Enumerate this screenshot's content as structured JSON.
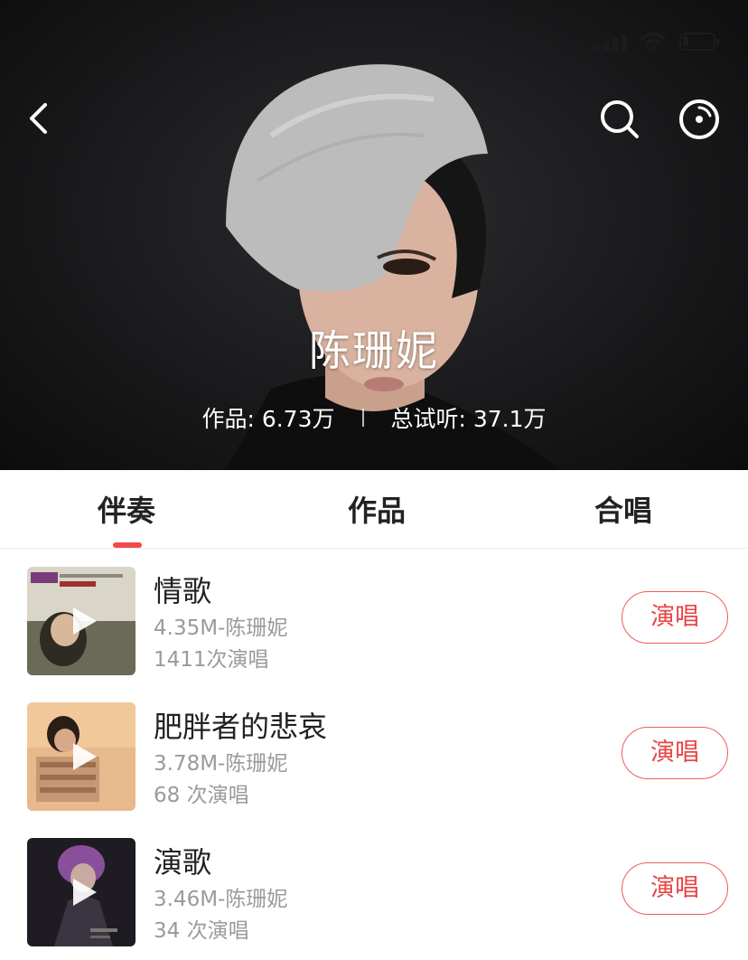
{
  "header": {
    "artist_name": "陈珊妮",
    "stats": {
      "works": "作品: 6.73万",
      "plays": "总试听: 37.1万"
    },
    "icons": [
      "back-arrow-icon",
      "search-icon",
      "disc-icon"
    ]
  },
  "status_bar": {
    "icons": [
      "signal-icon",
      "wifi-icon",
      "battery-icon"
    ]
  },
  "tabs": [
    {
      "label": "伴奏",
      "active": true
    },
    {
      "label": "作品",
      "active": false
    },
    {
      "label": "合唱",
      "active": false
    }
  ],
  "songs": [
    {
      "title": "情歌",
      "meta": "4.35M-陈珊妮",
      "count": "1411次演唱",
      "action": "演唱"
    },
    {
      "title": "肥胖者的悲哀",
      "meta": "3.78M-陈珊妮",
      "count": "68 次演唱",
      "action": "演唱"
    },
    {
      "title": "演歌",
      "meta": "3.46M-陈珊妮",
      "count": "34 次演唱",
      "action": "演唱"
    }
  ],
  "colors": {
    "accent": "#f04b4b",
    "hero_bg": "#1a1a1c",
    "meta_text": "#9a9a9a"
  }
}
